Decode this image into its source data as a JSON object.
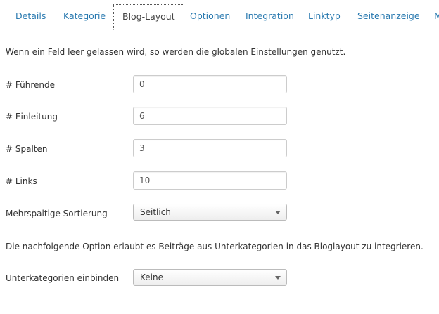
{
  "tabs": [
    {
      "label": "Details"
    },
    {
      "label": "Kategorie"
    },
    {
      "label": "Blog-Layout"
    },
    {
      "label": "Optionen"
    },
    {
      "label": "Integration"
    },
    {
      "label": "Linktyp"
    },
    {
      "label": "Seitenanzeige"
    },
    {
      "label": "M"
    }
  ],
  "active_tab": "Blog-Layout",
  "intro_note": "Wenn ein Feld leer gelassen wird, so werden die globalen Einstellungen genutzt.",
  "fields": {
    "leading": {
      "label": "# Führende",
      "value": "0"
    },
    "intro": {
      "label": "# Einleitung",
      "value": "6"
    },
    "columns": {
      "label": "# Spalten",
      "value": "3"
    },
    "links": {
      "label": "# Links",
      "value": "10"
    },
    "multi_column_order": {
      "label": "Mehrspaltige Sortierung",
      "value": "Seitlich"
    }
  },
  "subcategory_note": "Die nachfolgende Option erlaubt es Beiträge aus Unterkategorien in das Bloglayout zu integrieren.",
  "subcategories": {
    "label": "Unterkategorien einbinden",
    "value": "Keine"
  },
  "colors": {
    "link": "#2a7ab0",
    "text": "#333333",
    "border": "#cccccc"
  }
}
